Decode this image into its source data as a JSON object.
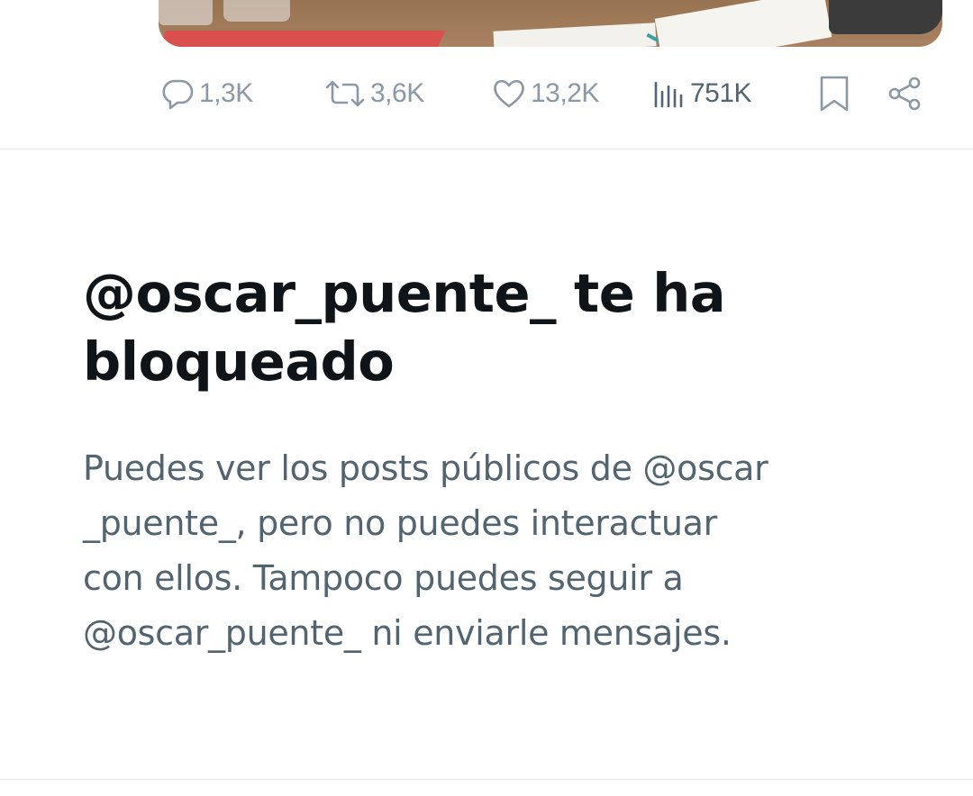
{
  "post": {
    "media": {
      "description_hidden": ""
    },
    "actions": {
      "replies": "1,3K",
      "reposts": "3,6K",
      "likes": "13,2K",
      "views": "751K"
    }
  },
  "blocked_notice": {
    "title_line1": "@oscar_puente_ te ha",
    "title_line2": "bloqueado",
    "desc_line1": "Puedes ver los posts públicos de @oscar",
    "desc_line2": "_puente_, pero no puedes interactuar",
    "desc_line3": "con ellos. Tampoco puedes seguir a",
    "desc_line4": "@oscar_puente_ ni enviarle mensajes."
  },
  "colors": {
    "primary_text": "#0f1419",
    "secondary_text": "#536471",
    "icon_gray": "#8b98a5",
    "divider": "#e1e4e8"
  },
  "icons": [
    "reply-icon",
    "repost-icon",
    "like-icon",
    "views-icon",
    "bookmark-icon",
    "share-icon"
  ]
}
